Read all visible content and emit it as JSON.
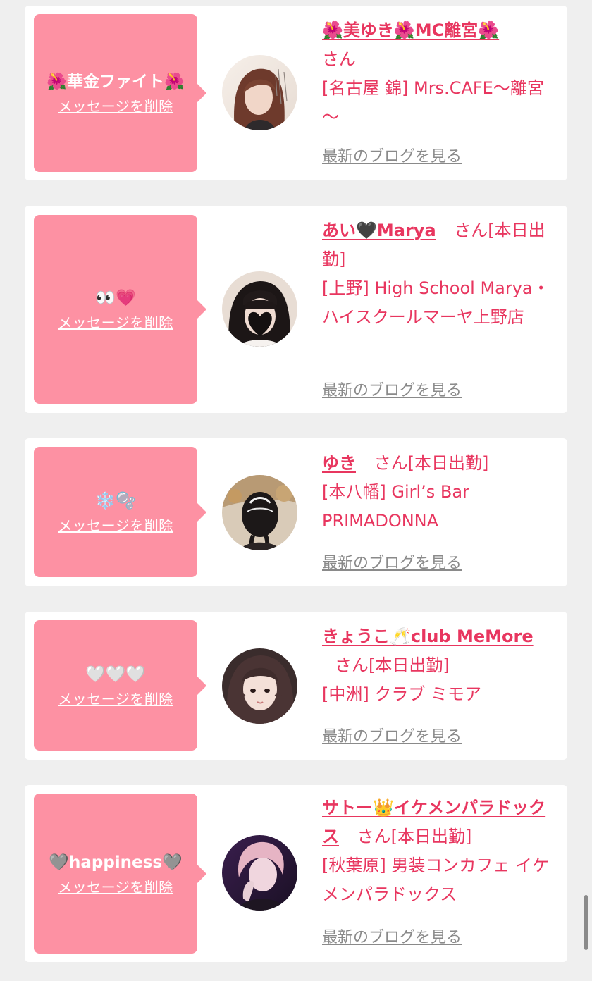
{
  "colors": {
    "page_bg": "#efefef",
    "card_bg": "#ffffff",
    "bubble_pink": "#fd91a3",
    "accent_red": "#e8365f",
    "blog_link_gray": "#8a8a8a"
  },
  "delete_label": "メッセージを削除",
  "blog_label": "最新のブログを見る",
  "san_suffix": "さん",
  "items": [
    {
      "message": "🌺華金ファイト🌺",
      "name": "🌺美ゆき🌺MC離宮🌺",
      "status": "",
      "shop": "[名古屋 錦] Mrs.CAFE～離宮～"
    },
    {
      "message": "👀💗",
      "name": "あい🖤Marya",
      "status": "[本日出勤]",
      "shop": "[上野] High School Marya・ハイスクールマーヤ上野店"
    },
    {
      "message": "❄️🫧",
      "name": "ゆき",
      "status": "[本日出勤]",
      "shop": "[本八幡] Girl’s Bar PRIMADONNA"
    },
    {
      "message": "🤍🤍🤍",
      "name": "きょうこ🥂club MeMore",
      "status": "[本日出勤]",
      "shop": "[中洲] クラブ ミモア"
    },
    {
      "message": "🩶happiness🩶",
      "name": "サトー👑イケメンパラドックス",
      "status": "[本日出勤]",
      "shop": "[秋葉原] 男装コンカフェ イケメンパラドックス"
    }
  ]
}
